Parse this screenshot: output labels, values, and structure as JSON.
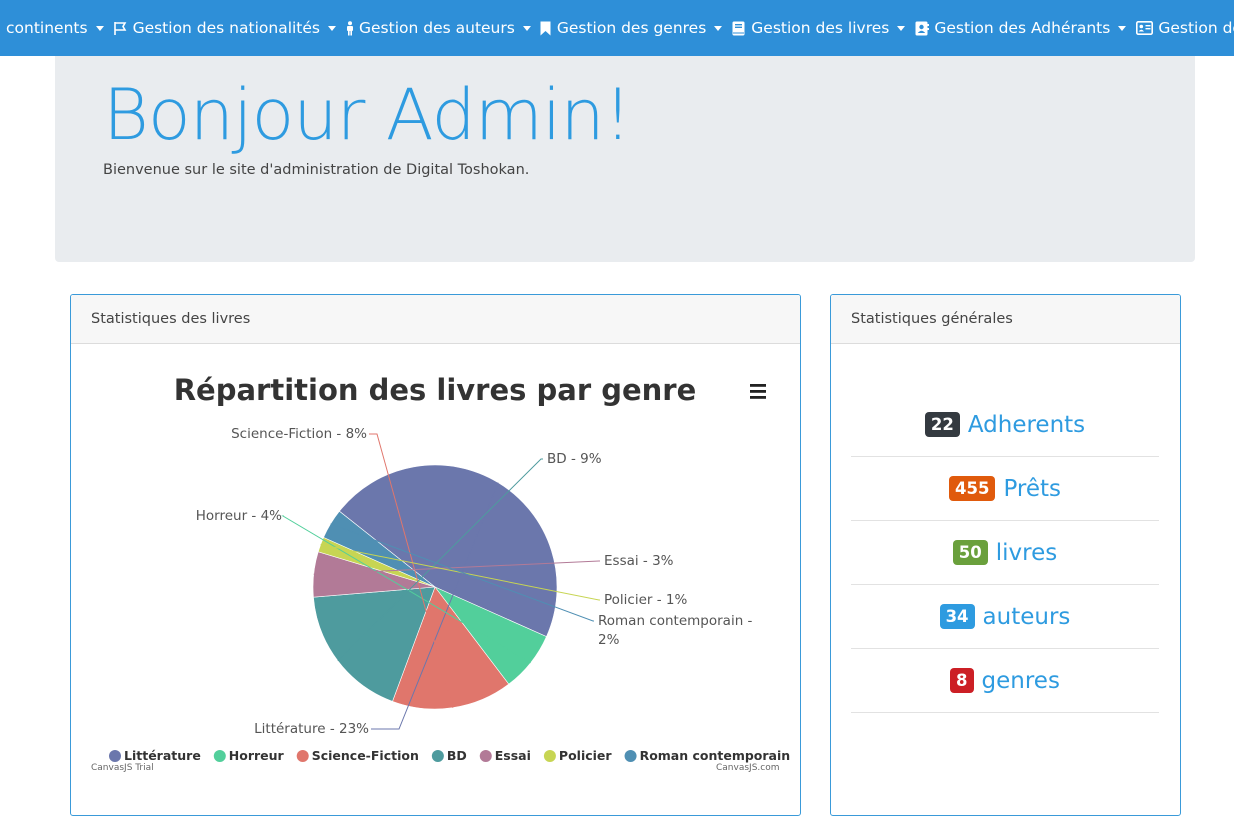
{
  "nav": {
    "items": [
      {
        "label": "continents",
        "icon": "none"
      },
      {
        "label": "Gestion des nationalités",
        "icon": "flag-icon"
      },
      {
        "label": "Gestion des auteurs",
        "icon": "person-icon"
      },
      {
        "label": "Gestion des genres",
        "icon": "bookmark-icon"
      },
      {
        "label": "Gestion des livres",
        "icon": "book-icon"
      },
      {
        "label": "Gestion des Adhérants",
        "icon": "address-book-icon"
      },
      {
        "label": "Gestion des Prêts",
        "icon": "id-card-icon"
      }
    ]
  },
  "jumbotron": {
    "title": "Bonjour Admin!",
    "subtitle": "Bienvenue sur le site d'administration de Digital Toshokan."
  },
  "books_card": {
    "header": "Statistiques des livres"
  },
  "general_card": {
    "header": "Statistiques générales",
    "stats": [
      {
        "count": "22",
        "label": "Adherents",
        "color": "#343a40"
      },
      {
        "count": "455",
        "label": "Prêts",
        "color": "#e05a0c"
      },
      {
        "count": "50",
        "label": "livres",
        "color": "#6aa03c"
      },
      {
        "count": "34",
        "label": "auteurs",
        "color": "#2e9be0"
      },
      {
        "count": "8",
        "label": "genres",
        "color": "#cc1f25"
      }
    ]
  },
  "chart_data": {
    "type": "pie",
    "title": "Répartition des livres par genre",
    "series": [
      {
        "name": "Littérature",
        "value": 23,
        "index_label": "Littérature - 23%",
        "color": "#6b77ac"
      },
      {
        "name": "Horreur",
        "value": 4,
        "index_label": "Horreur - 4%",
        "color": "#52cf9b"
      },
      {
        "name": "Science-Fiction",
        "value": 8,
        "index_label": "Science-Fiction - 8%",
        "color": "#e0766c"
      },
      {
        "name": "BD",
        "value": 9,
        "index_label": "BD - 9%",
        "color": "#4e9b9e"
      },
      {
        "name": "Essai",
        "value": 3,
        "index_label": "Essai - 3%",
        "color": "#b27a97"
      },
      {
        "name": "Policier",
        "value": 1,
        "index_label": "Policier - 1%",
        "color": "#c7d553"
      },
      {
        "name": "Roman contemporain",
        "value": 2,
        "index_label": "Roman contemporain - 2%",
        "color": "#4f8fb3"
      }
    ],
    "legend": "bottom",
    "credit_left": "CanvasJS Trial",
    "credit_right": "CanvasJS.com"
  }
}
